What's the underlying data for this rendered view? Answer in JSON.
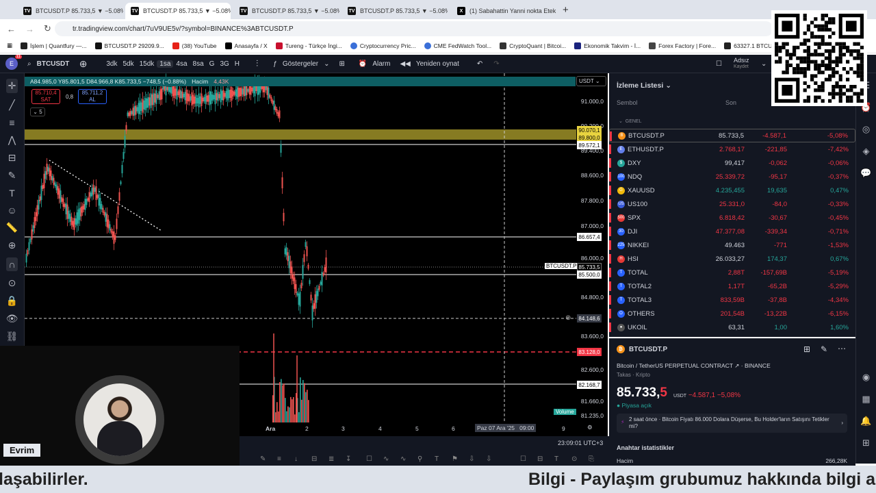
{
  "browser": {
    "tabs": [
      {
        "label": "BTCUSDT.P 85.733,5 ▼ −5.08%",
        "active": false
      },
      {
        "label": "BTCUSDT.P 85.733,5 ▼ −5.08%",
        "active": true
      },
      {
        "label": "BTCUSDT.P 85.733,5 ▼ −5.08%",
        "active": false
      },
      {
        "label": "BTCUSDT.P 85.733,5 ▼ −5.08%",
        "active": false
      },
      {
        "label": "(1) Sabahattin Yanni nokta Etek",
        "active": false
      }
    ],
    "url": "tr.tradingview.com/chart/7uV9UE5v/?symbol=BINANCE%3ABTCUSDT.P",
    "bookmarks": [
      "İşlem | Quantfury —...",
      "BTCUSDT.P 29209.9...",
      "(38) YouTube",
      "Anasayfa / X",
      "Tureng - Türkçe İngi...",
      "Cryptocurrency Pric...",
      "CME FedWatch Tool...",
      "CryptoQuant | Bitcoi...",
      "Ekonomik Takvim - İ...",
      "Forex Factory | Fore...",
      "63327.1 BTCUSDT Bi..."
    ]
  },
  "toolbar": {
    "avatar": "E",
    "notif": "11",
    "symbol": "BTCUSDT",
    "timeframes": [
      "3dk",
      "5dk",
      "15dk",
      "1sa",
      "4sa",
      "8sa",
      "G",
      "3G",
      "H"
    ],
    "selected_timeframe": "1sa",
    "indicators": "Göstergeler",
    "alarm": "Alarm",
    "replay": "Yeniden oynat",
    "user_name": "Adsız",
    "user_status": "Kaydet"
  },
  "chart": {
    "ohlc_text": "A84.985,0 Y85.801,5 D84.966,8 K85.733,5 −748,5 (−0.88%)",
    "volume_label": "Hacim",
    "volume_value": "4,43K",
    "sell_price": "85.710,4",
    "sell_label": "SAT",
    "spread": "0,8",
    "buy_price": "85.711,2",
    "buy_label": "AL",
    "indicator_count": "5",
    "currency": "USDT",
    "price_ticks": [
      "91.000,0",
      "90.200,0",
      "89.400,0",
      "88.600,0",
      "87.800,0",
      "87.000,0",
      "86.000,0",
      "84.800,0",
      "83.600,0",
      "82.600,0",
      "81.660,0",
      "81.235,0"
    ],
    "price_tags": {
      "top1": "90.070,1",
      "top2": "89.800,0",
      "t3": "89.572,1",
      "t4": "86.657,4",
      "current": "85.733,5",
      "t5": "85.500,0",
      "cross": "84.148,6",
      "red": "83.128,0",
      "t6": "82.168,7"
    },
    "current_symbol_tag": "BTCUSDT.P",
    "volume_tag": "Volume",
    "x_labels": [
      "Ara",
      "2",
      "3",
      "4",
      "5",
      "6",
      "9"
    ],
    "cursor_date": "Paz 07 Ara '25",
    "cursor_time": "09:00",
    "clock": "23:09:01 UTC+3"
  },
  "watchlist": {
    "title": "İzleme Listesi",
    "col_symbol": "Sembol",
    "col_last": "Son",
    "group": "GENEL",
    "rows": [
      {
        "sym": "BTCUSDT.P",
        "last": "85.733,5",
        "chg": "-4.587,1",
        "pct": "-5,08%",
        "dir": "dn",
        "color": "#f7931a",
        "icon": "B"
      },
      {
        "sym": "ETHUSDT.P",
        "last": "2.768,17",
        "chg": "-221,85",
        "pct": "-7,42%",
        "dir": "dn",
        "color": "#627eea",
        "icon": "E"
      },
      {
        "sym": "DXY",
        "last": "99,417",
        "chg": "-0,062",
        "pct": "-0,06%",
        "dir": "dn",
        "color": "#26a69a",
        "icon": "$"
      },
      {
        "sym": "NDQ",
        "last": "25.339,72",
        "chg": "-95,17",
        "pct": "-0,37%",
        "dir": "dn",
        "color": "#2962ff",
        "icon": "100"
      },
      {
        "sym": "XAUUSD",
        "last": "4.235,455",
        "chg": "19,635",
        "pct": "0,47%",
        "dir": "up",
        "color": "#f0b90b",
        "icon": "G"
      },
      {
        "sym": "US100",
        "last": "25.331,0",
        "chg": "-84,0",
        "pct": "-0,33%",
        "dir": "dn",
        "color": "#3a5bd9",
        "icon": "US"
      },
      {
        "sym": "SPX",
        "last": "6.818,42",
        "chg": "-30,67",
        "pct": "-0,45%",
        "dir": "dn",
        "color": "#e53935",
        "icon": "500"
      },
      {
        "sym": "DJI",
        "last": "47.377,08",
        "chg": "-339,34",
        "pct": "-0,71%",
        "dir": "dn",
        "color": "#2962ff",
        "icon": "30"
      },
      {
        "sym": "NIKKEI",
        "last": "49.463",
        "chg": "-771",
        "pct": "-1,53%",
        "dir": "dn",
        "color": "#2962ff",
        "icon": "225"
      },
      {
        "sym": "HSI",
        "last": "26.033,27",
        "chg": "174,37",
        "pct": "0,67%",
        "dir": "up",
        "color": "#e53935",
        "icon": "H"
      },
      {
        "sym": "TOTAL",
        "last": "2,88T",
        "chg": "-157,69B",
        "pct": "-5,19%",
        "dir": "dn",
        "color": "#2962ff",
        "icon": "T"
      },
      {
        "sym": "TOTAL2",
        "last": "1,17T",
        "chg": "-65,2B",
        "pct": "-5,29%",
        "dir": "dn",
        "color": "#2962ff",
        "icon": "T"
      },
      {
        "sym": "TOTAL3",
        "last": "833,59B",
        "chg": "-37,8B",
        "pct": "-4,34%",
        "dir": "dn",
        "color": "#2962ff",
        "icon": "T"
      },
      {
        "sym": "OTHERS",
        "last": "201,54B",
        "chg": "-13,22B",
        "pct": "-6,15%",
        "dir": "dn",
        "color": "#2962ff",
        "icon": "O"
      },
      {
        "sym": "UKOIL",
        "last": "63,31",
        "chg": "1,00",
        "pct": "1,60%",
        "dir": "up",
        "color": "#555",
        "icon": "●"
      }
    ]
  },
  "details": {
    "symbol": "BTCUSDT.P",
    "full_name": "Bitcoin / TetherUS PERPETUAL CONTRACT",
    "exchange": "BINANCE",
    "category": "Takas · Kripto",
    "price_main": "85.733,",
    "price_last": "5",
    "currency": "USDT",
    "change": "−4.587,1",
    "change_pct": "−5,08%",
    "market_status": "Piyasa açık",
    "news": "2 saat önce · Bitcoin Fiyatı 86.000 Dolara Düşerse, Bu Holder'ların Satışını Tetikler mi?",
    "stats_title": "Anahtar istatistikler",
    "volume_label": "Hacim",
    "volume_value": "266,28K"
  },
  "webcam": {
    "name": "Evrim"
  },
  "ticker": {
    "left": "laşabilirler.",
    "right": "Bilgi - Paylaşım grubumuz hakkında bilgi a"
  }
}
